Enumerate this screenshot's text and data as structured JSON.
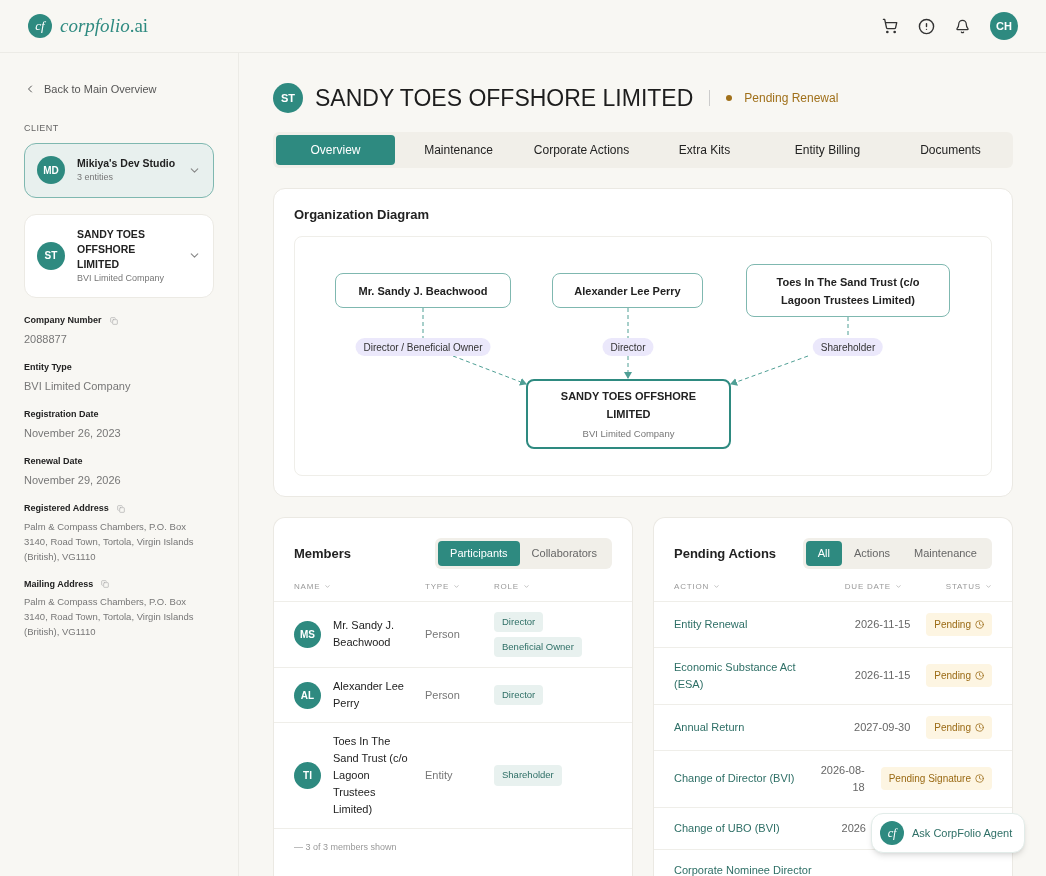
{
  "header": {
    "logo_mark": "cf",
    "logo_text": "*corpfolio*.ai",
    "user_initials": "CH"
  },
  "sidebar": {
    "back_link": "Back to Main Overview",
    "section_label": "CLIENT",
    "client": {
      "initials": "MD",
      "name": "Mikiya's Dev Studio",
      "subtitle": "3 entities",
      "selected": true
    },
    "entity": {
      "initials": "ST",
      "name": "SANDY TOES OFFSHORE LIMITED",
      "subtitle": "BVI Limited Company",
      "selected": false
    },
    "fields": [
      {
        "label": "Company Number",
        "value": "2088877",
        "copyable": true
      },
      {
        "label": "Entity Type",
        "value": "BVI Limited Company",
        "copyable": false
      },
      {
        "label": "Registration Date",
        "value": "November 26, 2023",
        "copyable": false
      },
      {
        "label": "Renewal Date",
        "value": "November 29, 2026",
        "copyable": false
      },
      {
        "label": "Registered Address",
        "value": "Palm & Compass Chambers, P.O. Box 3140, Road Town, Tortola, Virgin Islands (British), VG1110",
        "copyable": true
      },
      {
        "label": "Mailing Address",
        "value": "Palm & Compass Chambers, P.O. Box 3140, Road Town, Tortola, Virgin Islands (British), VG1110",
        "copyable": true
      }
    ]
  },
  "entity_header": {
    "initials": "ST",
    "title": "SANDY TOES OFFSHORE LIMITED",
    "status": "Pending Renewal"
  },
  "tabs": [
    {
      "label": "Overview",
      "selected": true
    },
    {
      "label": "Maintenance",
      "selected": false
    },
    {
      "label": "Corporate Actions",
      "selected": false
    },
    {
      "label": "Extra Kits",
      "selected": false
    },
    {
      "label": "Entity Billing",
      "selected": false
    },
    {
      "label": "Documents",
      "selected": false
    }
  ],
  "org_diagram": {
    "title": "Organization Diagram",
    "owners": [
      {
        "name": "Mr. Sandy J. Beachwood",
        "relation": "Director / Beneficial Owner"
      },
      {
        "name": "Alexander Lee Perry",
        "relation": "Director"
      },
      {
        "name": "Toes In The Sand Trust (c/o Lagoon Trustees Limited)",
        "relation": "Shareholder"
      }
    ],
    "entity": {
      "name": "SANDY TOES OFFSHORE LIMITED",
      "type": "BVI Limited Company"
    }
  },
  "members": {
    "title": "Members",
    "filters": [
      {
        "label": "Participants",
        "selected": true
      },
      {
        "label": "Collaborators",
        "selected": false
      }
    ],
    "columns": [
      "NAME",
      "TYPE",
      "ROLE"
    ],
    "rows": [
      {
        "initials": "MS",
        "name": "Mr. Sandy J. Beachwood",
        "type": "Person",
        "roles": [
          "Director",
          "Beneficial Owner"
        ]
      },
      {
        "initials": "AL",
        "name": "Alexander Lee Perry",
        "type": "Person",
        "roles": [
          "Director"
        ]
      },
      {
        "initials": "TI",
        "name": "Toes In The Sand Trust (c/o Lagoon Trustees Limited)",
        "type": "Entity",
        "roles": [
          "Shareholder"
        ]
      }
    ],
    "footer": "— 3 of 3 members shown"
  },
  "pending_actions": {
    "title": "Pending Actions",
    "filters": [
      {
        "label": "All",
        "selected": true
      },
      {
        "label": "Actions",
        "selected": false
      },
      {
        "label": "Maintenance",
        "selected": false
      }
    ],
    "columns": [
      "ACTION",
      "DUE DATE",
      "STATUS"
    ],
    "rows": [
      {
        "action": "Entity Renewal",
        "due_date": "2026-11-15",
        "status": "Pending"
      },
      {
        "action": "Economic Substance Act (ESA)",
        "due_date": "2026-11-15",
        "status": "Pending"
      },
      {
        "action": "Annual Return",
        "due_date": "2027-09-30",
        "status": "Pending"
      },
      {
        "action": "Change of Director (BVI)",
        "due_date": "2026-08-18",
        "status": "Pending Signature"
      },
      {
        "action": "Change of UBO (BVI)",
        "due_date": "2026"
      },
      {
        "action": "Corporate Nominee Director"
      }
    ]
  },
  "agent_button": {
    "mark": "cf",
    "label": "Ask CorpFolio Agent"
  }
}
